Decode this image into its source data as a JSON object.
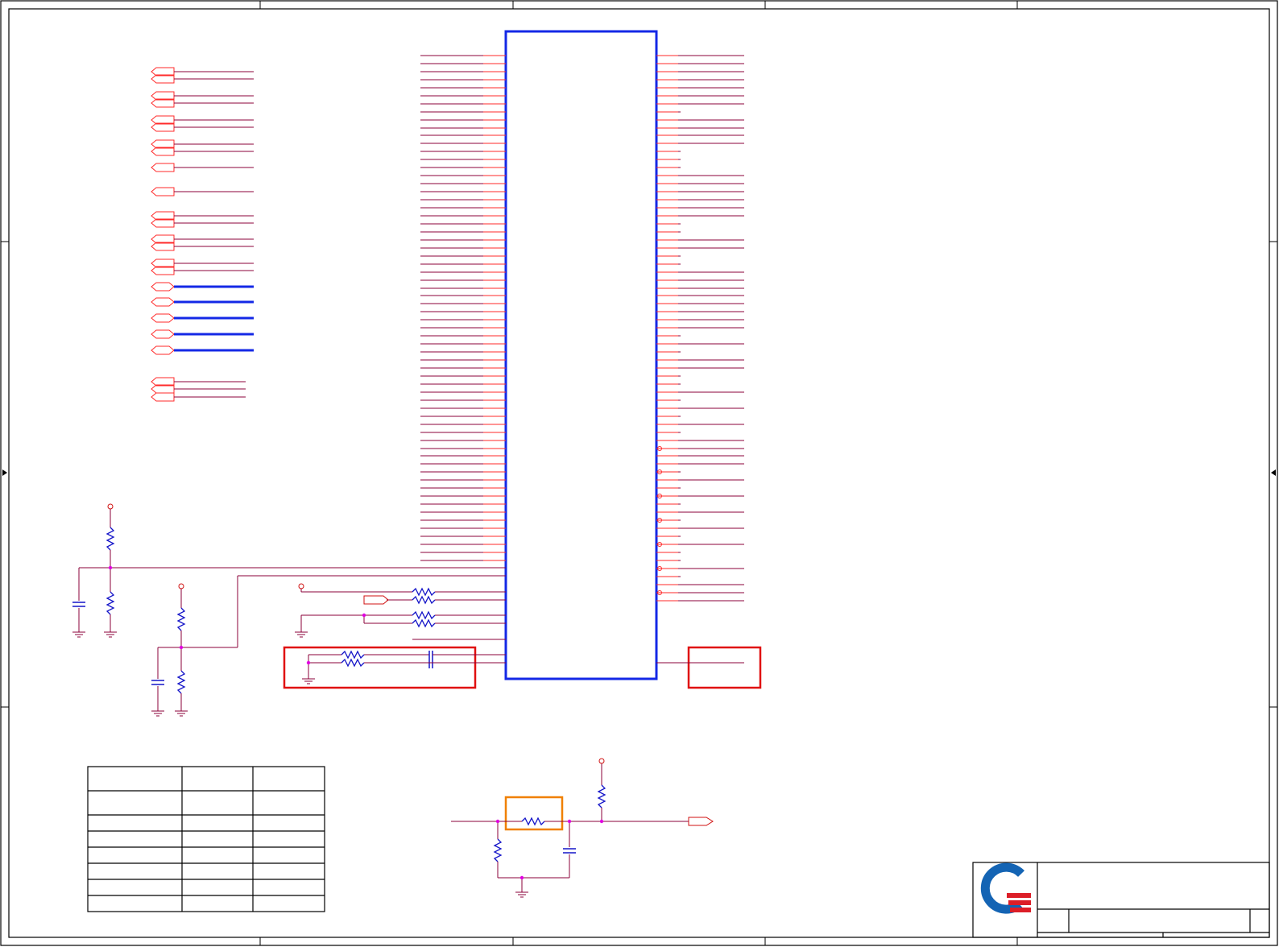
{
  "sheet": {
    "colors": {
      "border": "#000000",
      "wire": "#8b0038",
      "pin": "#ff2a2a",
      "bus": "#1428e6",
      "component": "#1414c8",
      "junction": "#e000e0",
      "power_port": "#d01010",
      "highlight_red": "#e01010",
      "highlight_orange": "#f08000",
      "logo_blue": "#1464b4",
      "logo_red": "#dc1e28"
    },
    "title_block": {
      "logo": "company-logo",
      "title": "",
      "sheet": "",
      "rev": ""
    },
    "table": {
      "header": [
        "",
        "",
        ""
      ],
      "rows": [
        [
          "",
          "",
          ""
        ],
        [
          "",
          "",
          ""
        ],
        [
          "",
          "",
          ""
        ],
        [
          "",
          "",
          ""
        ],
        [
          "",
          "",
          ""
        ],
        [
          "",
          "",
          ""
        ]
      ]
    }
  }
}
